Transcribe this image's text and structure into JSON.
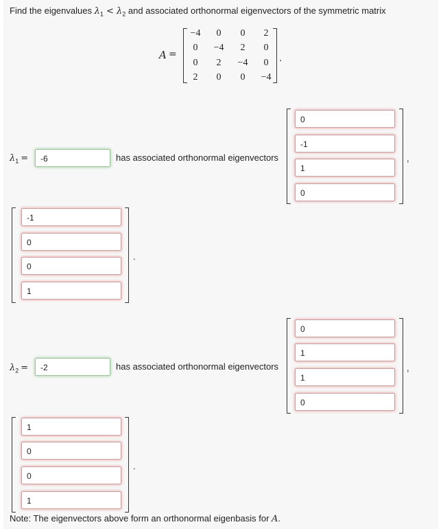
{
  "question": {
    "prefix": "Find the eigenvalues ",
    "l1": "λ",
    "s1": "1",
    "lt": " < ",
    "l2": "λ",
    "s2": "2",
    "suffix": " and associated orthonormal eigenvectors of the symmetric matrix"
  },
  "matrix": {
    "label": "A",
    "eq": "=",
    "rows": [
      [
        "−4",
        "0",
        "0",
        "2"
      ],
      [
        "0",
        "−4",
        "2",
        "0"
      ],
      [
        "0",
        "2",
        "−4",
        "0"
      ],
      [
        "2",
        "0",
        "0",
        "−4"
      ]
    ],
    "period": "."
  },
  "eigen1": {
    "lambda_sym": "λ",
    "sub": "1",
    "eq": "=",
    "value": "-6",
    "text": "has associated orthonormal eigenvectors",
    "vec_a": [
      "0",
      "-1",
      "1",
      "0"
    ],
    "comma": ",",
    "vec_b": [
      "-1",
      "0",
      "0",
      "1"
    ],
    "period": "."
  },
  "eigen2": {
    "lambda_sym": "λ",
    "sub": "2",
    "eq": "=",
    "value": "-2",
    "text": "has associated orthonormal eigenvectors",
    "vec_a": [
      "0",
      "1",
      "1",
      "0"
    ],
    "comma": ",",
    "vec_b": [
      "1",
      "0",
      "0",
      "1"
    ],
    "period": "."
  },
  "note": {
    "text": "Note: The eigenvectors above form an orthonormal eigenbasis for ",
    "var": "A",
    "end": "."
  }
}
